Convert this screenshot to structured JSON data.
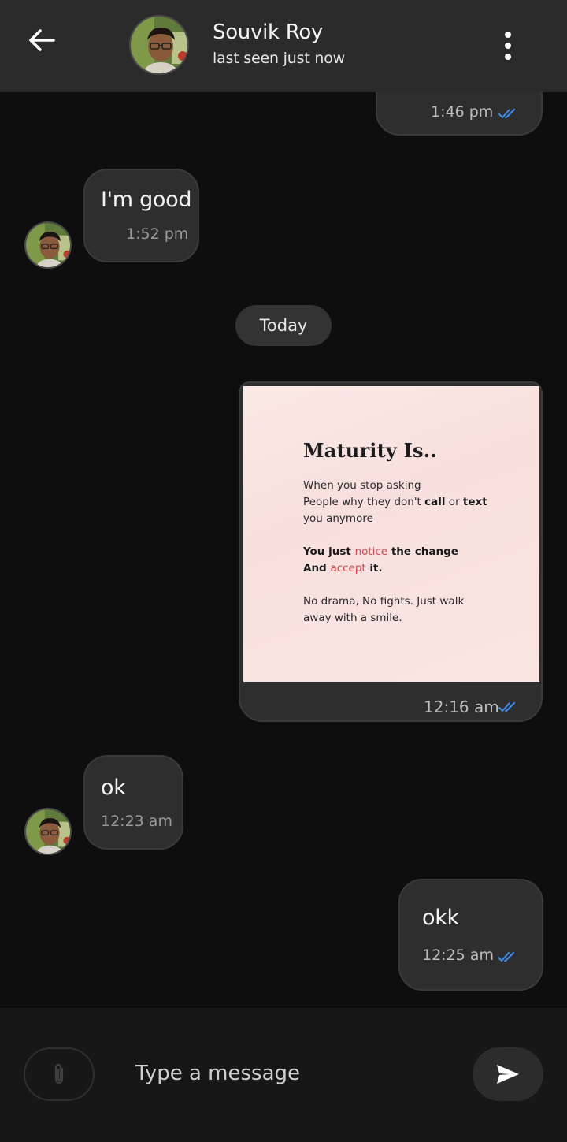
{
  "header": {
    "contact_name": "Souvik Roy",
    "status": "last seen just now"
  },
  "date_separator": "Today",
  "messages": [
    {
      "direction": "outgoing",
      "text": "",
      "time": "1:46 pm"
    },
    {
      "direction": "incoming",
      "text": "I'm good",
      "time": "1:52 pm"
    },
    {
      "direction": "outgoing",
      "type": "image",
      "time": "12:16 am",
      "image": {
        "title": "Maturity Is..",
        "line1": "When you stop asking",
        "line2_a": "People why they don't ",
        "line2_b": "call",
        "line2_c": " or ",
        "line2_d": "text",
        "line3": "you anymore",
        "line4_a": "You just ",
        "line4_b": "notice",
        "line4_c": " the change",
        "line5_a": "And ",
        "line5_b": "accept",
        "line5_c": " it.",
        "line6": "No drama, No fights. Just walk",
        "line7": "away with a smile."
      }
    },
    {
      "direction": "incoming",
      "text": "ok",
      "time": "12:23 am"
    },
    {
      "direction": "outgoing",
      "text": "okk",
      "time": "12:25 am"
    }
  ],
  "input": {
    "placeholder": "Type a message",
    "value": ""
  },
  "colors": {
    "background": "#0e0e0e",
    "header": "#2b2b2b",
    "bubble": "#2e2e2e",
    "read_tick": "#3d8ef0",
    "accent_red": "#d9464e"
  },
  "icons": {
    "back": "arrow-left-icon",
    "menu": "more-vertical-icon",
    "attach": "paperclip-icon",
    "send": "send-icon",
    "read": "double-check-icon"
  }
}
